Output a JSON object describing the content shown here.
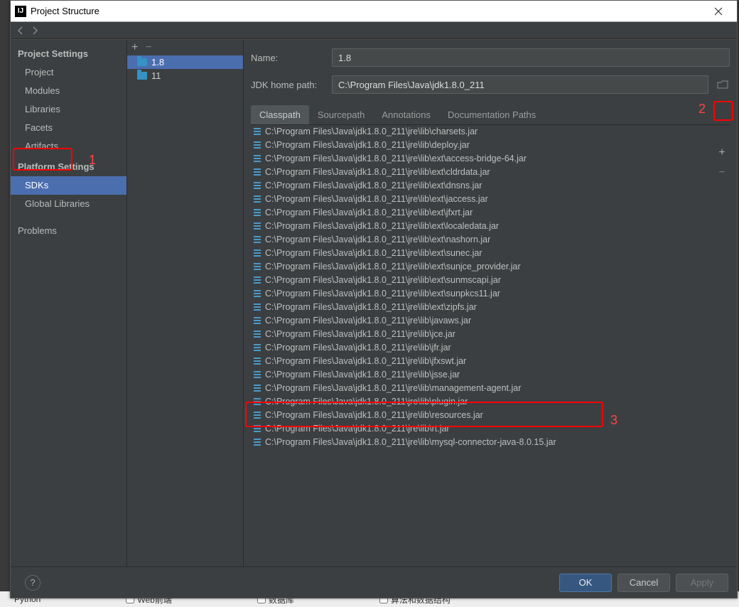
{
  "window_title": "Project Structure",
  "sidebar": {
    "heading1": "Project Settings",
    "items1": [
      "Project",
      "Modules",
      "Libraries",
      "Facets",
      "Artifacts"
    ],
    "heading2": "Platform Settings",
    "items2": [
      "SDKs",
      "Global Libraries"
    ],
    "heading3_item": "Problems"
  },
  "sdk_list": [
    "1.8",
    "11"
  ],
  "fields": {
    "name_label": "Name:",
    "name_value": "1.8",
    "home_label": "JDK home path:",
    "home_value": "C:\\Program Files\\Java\\jdk1.8.0_211"
  },
  "tabs": [
    "Classpath",
    "Sourcepath",
    "Annotations",
    "Documentation Paths"
  ],
  "classpath_entries": [
    "C:\\Program Files\\Java\\jdk1.8.0_211\\jre\\lib\\charsets.jar",
    "C:\\Program Files\\Java\\jdk1.8.0_211\\jre\\lib\\deploy.jar",
    "C:\\Program Files\\Java\\jdk1.8.0_211\\jre\\lib\\ext\\access-bridge-64.jar",
    "C:\\Program Files\\Java\\jdk1.8.0_211\\jre\\lib\\ext\\cldrdata.jar",
    "C:\\Program Files\\Java\\jdk1.8.0_211\\jre\\lib\\ext\\dnsns.jar",
    "C:\\Program Files\\Java\\jdk1.8.0_211\\jre\\lib\\ext\\jaccess.jar",
    "C:\\Program Files\\Java\\jdk1.8.0_211\\jre\\lib\\ext\\jfxrt.jar",
    "C:\\Program Files\\Java\\jdk1.8.0_211\\jre\\lib\\ext\\localedata.jar",
    "C:\\Program Files\\Java\\jdk1.8.0_211\\jre\\lib\\ext\\nashorn.jar",
    "C:\\Program Files\\Java\\jdk1.8.0_211\\jre\\lib\\ext\\sunec.jar",
    "C:\\Program Files\\Java\\jdk1.8.0_211\\jre\\lib\\ext\\sunjce_provider.jar",
    "C:\\Program Files\\Java\\jdk1.8.0_211\\jre\\lib\\ext\\sunmscapi.jar",
    "C:\\Program Files\\Java\\jdk1.8.0_211\\jre\\lib\\ext\\sunpkcs11.jar",
    "C:\\Program Files\\Java\\jdk1.8.0_211\\jre\\lib\\ext\\zipfs.jar",
    "C:\\Program Files\\Java\\jdk1.8.0_211\\jre\\lib\\javaws.jar",
    "C:\\Program Files\\Java\\jdk1.8.0_211\\jre\\lib\\jce.jar",
    "C:\\Program Files\\Java\\jdk1.8.0_211\\jre\\lib\\jfr.jar",
    "C:\\Program Files\\Java\\jdk1.8.0_211\\jre\\lib\\jfxswt.jar",
    "C:\\Program Files\\Java\\jdk1.8.0_211\\jre\\lib\\jsse.jar",
    "C:\\Program Files\\Java\\jdk1.8.0_211\\jre\\lib\\management-agent.jar",
    "C:\\Program Files\\Java\\jdk1.8.0_211\\jre\\lib\\plugin.jar",
    "C:\\Program Files\\Java\\jdk1.8.0_211\\jre\\lib\\resources.jar",
    "C:\\Program Files\\Java\\jdk1.8.0_211\\jre\\lib\\rt.jar",
    "C:\\Program Files\\Java\\jdk1.8.0_211\\jre\\lib\\mysql-connector-java-8.0.15.jar"
  ],
  "buttons": {
    "ok": "OK",
    "cancel": "Cancel",
    "apply": "Apply"
  },
  "annotations": {
    "a1": "1",
    "a2": "2",
    "a3": "3"
  },
  "backdrop_tabs": {
    "python": "Python",
    "web": "Web前端",
    "db": "数据库",
    "algo": "算法和数据结构"
  }
}
